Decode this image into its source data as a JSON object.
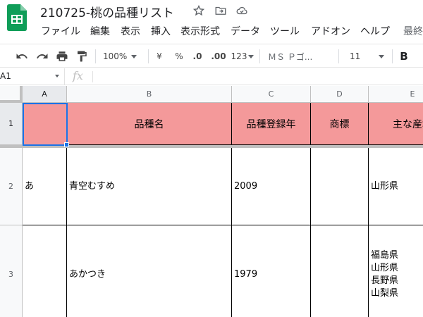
{
  "document": {
    "title": "210725-桃の品種リスト"
  },
  "menu": {
    "items": [
      "ファイル",
      "編集",
      "表示",
      "挿入",
      "表示形式",
      "データ",
      "ツール",
      "アドオン",
      "ヘルプ",
      "最終"
    ]
  },
  "toolbar": {
    "zoom": "100%",
    "currency": "¥",
    "percent": "%",
    "decrease_decimal": ".0",
    "increase_decimal": ".00",
    "number_format": "123",
    "font_name": "ＭＳ Ｐゴ...",
    "font_size": "11",
    "bold": "B"
  },
  "formula_bar": {
    "cell_ref": "A1",
    "fx_label": "fx",
    "content": ""
  },
  "grid": {
    "columns": [
      "A",
      "B",
      "C",
      "D",
      "E"
    ],
    "rows": [
      "1",
      "2",
      "3"
    ],
    "header_row": [
      "",
      "品種名",
      "品種登録年",
      "商標",
      "主な産地"
    ],
    "data_rows": [
      [
        "あ",
        "青空むすめ",
        "2009",
        "",
        "山形県"
      ],
      [
        "",
        "あかつき",
        "1979",
        "",
        "福島県\n山形県\n長野県\n山梨県"
      ]
    ],
    "header_fill_color": "#f4999a",
    "selection_color": "#1a73e8"
  }
}
